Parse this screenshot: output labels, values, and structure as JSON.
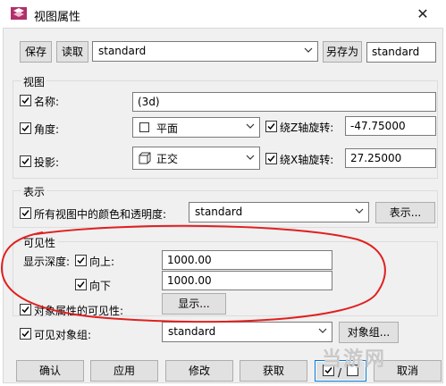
{
  "window": {
    "title": "视图属性",
    "close_glyph": "✕"
  },
  "toolbar": {
    "save_label": "保存",
    "read_label": "读取",
    "config_value": "standard",
    "save_as_label": "另存为",
    "save_as_value": "standard"
  },
  "view": {
    "group_title": "视图",
    "name_label": "名称:",
    "name_value": "(3d)",
    "angle_label": "角度:",
    "angle_value": "平面",
    "rot_z_label": "绕Z轴旋转:",
    "rot_z_value": "-47.75000",
    "projection_label": "投影:",
    "projection_value": "正交",
    "rot_x_label": "绕X轴旋转:",
    "rot_x_value": "27.25000"
  },
  "representation": {
    "group_title": "表示",
    "colors_label": "所有视图中的颜色和透明度:",
    "colors_value": "standard",
    "button_label": "表示..."
  },
  "visibility": {
    "group_title": "可见性",
    "depth_label": "显示深度:",
    "up_label": "向上:",
    "up_value": "1000.00",
    "down_label": "向下",
    "down_value": "1000.00",
    "display_button": "显示...",
    "object_props_label": "对象属性的可见性:",
    "visible_groups_label": "可见对象组:",
    "visible_groups_value": "standard",
    "object_group_button": "对象组..."
  },
  "footer": {
    "ok_label": "确认",
    "apply_label": "应用",
    "modify_label": "修改",
    "get_label": "获取",
    "toggle_separator": "/",
    "cancel_label": "取消"
  },
  "watermark": {
    "text": "当游网"
  },
  "colors": {
    "annotation_red": "#e02020",
    "focus_blue": "#0078d7",
    "app_icon": "#b0306a"
  }
}
